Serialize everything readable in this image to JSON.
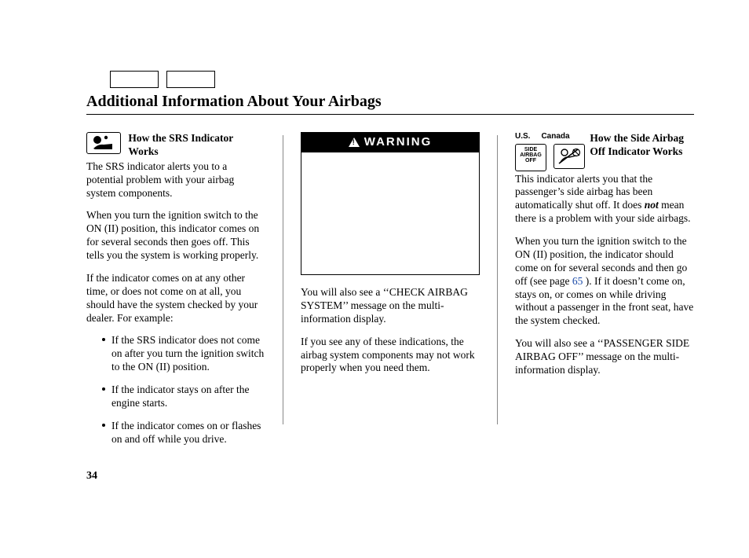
{
  "title": "Additional Information About Your Airbags",
  "page_number": "34",
  "col1": {
    "heading": "How the SRS Indicator Works",
    "p1": "The SRS indicator alerts you to a potential problem with your airbag system components.",
    "p2": "When you turn the ignition switch to the ON (II) position, this indicator comes on for several seconds then goes off. This tells you the system is working properly.",
    "p3": "If the indicator comes on at any other time, or does not come on at all, you should have the system checked by your dealer. For example:",
    "b1": "If the SRS indicator does not come on after you turn the ignition switch to the ON (II) position.",
    "b2": "If the indicator stays on after the engine starts.",
    "b3": "If the indicator comes on or flashes on and off while you drive."
  },
  "col2": {
    "warning_label": "WARNING",
    "p1": "You will also see a ‘‘CHECK AIRBAG SYSTEM’’ message on the multi-information display.",
    "p2": "If you see any of these indications, the airbag system components may not work properly when you need them."
  },
  "col3": {
    "region_us": "U.S.",
    "region_canada": "Canada",
    "us_icon_text": "SIDE\nAIRBAG\nOFF",
    "heading": "How the Side Airbag Off Indicator Works",
    "p1a": "This indicator alerts you that the passenger’s side airbag has been automatically shut off. It does ",
    "p1_not": "not",
    "p1b": " mean there is a problem with your side airbags.",
    "p2a": "When you turn the ignition switch to the ON (II) position, the indicator should come on for several seconds and then go off (see page ",
    "p2_ref": "65",
    "p2b": " ). If it doesn’t come on, stays on, or comes on while driving without a passenger in the front seat, have the system checked.",
    "p3": "You will also see a ‘‘PASSENGER SIDE AIRBAG OFF’’ message on the multi-information display."
  }
}
